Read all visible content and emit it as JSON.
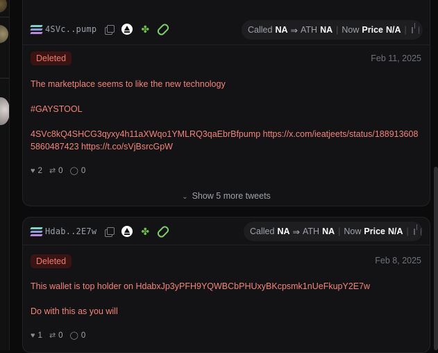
{
  "cards": [
    {
      "ticker": "4SVc..pump",
      "called_label": "Called",
      "called_value": "NA",
      "ath_label": "ATH",
      "ath_value": "NA",
      "now_label": "Now",
      "price_label": "Price",
      "price_value": "N/A",
      "status": "Deleted",
      "date": "Feb 11, 2025",
      "text": [
        "The marketplace seems to like the new technology",
        "#GAYSTOOL",
        "4SVc8kQ4SHCG3qyxy4h11aXWqo1YMLRQ3qaEbrBfpump https://x.com/ieatjeets/status/1889136085860487423 https://t.co/sVjBsrcGpW"
      ],
      "likes": "2",
      "retweets": "0",
      "replies": "0",
      "show_more": "Show 5 more tweets"
    },
    {
      "ticker": "Hdab..2E7w",
      "called_label": "Called",
      "called_value": "NA",
      "ath_label": "ATH",
      "ath_value": "NA",
      "now_label": "Now",
      "price_label": "Price",
      "price_value": "N/A",
      "status": "Deleted",
      "date": "Feb 8, 2025",
      "text": [
        "This wallet is top holder on HdabxJp3yPFH9YQWBCbPHUxyBKcpsmk1nUeFkupY2E7w",
        "Do with this as you will"
      ],
      "likes": "1",
      "retweets": "0",
      "replies": "0"
    }
  ],
  "icons": {
    "token_chain": "solana-icon",
    "copy": "copy-icon",
    "pump": "pump-fun-icon",
    "frog": "frog-icon",
    "link": "link-icon",
    "share": "share-icon",
    "refresh": "refresh-icon",
    "like": "heart-icon",
    "retweet": "retweet-icon",
    "reply": "reply-icon",
    "chevron": "chevron-down-icon"
  },
  "colors": {
    "tweet_text": "#f2857a",
    "badge_bg": "#3a1412",
    "badge_text": "#f07a70",
    "card_bg": "#131315",
    "page_bg": "#0b0b0c"
  }
}
